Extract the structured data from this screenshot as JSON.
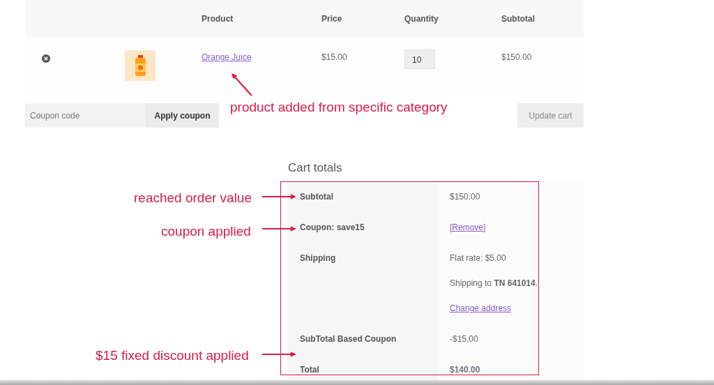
{
  "cart_table": {
    "columns": [
      "Product",
      "Price",
      "Quantity",
      "Subtotal"
    ],
    "items": [
      {
        "product": "Orange Juice",
        "price": "$15.00",
        "quantity": "10",
        "subtotal": "$150.00"
      }
    ]
  },
  "coupon_form": {
    "placeholder": "Coupon code",
    "apply_button": "Apply coupon",
    "update_button": "Update cart"
  },
  "cart_totals": {
    "title": "Cart totals",
    "rows": [
      {
        "kind": "amount",
        "label": "Subtotal",
        "value": "$150.00"
      },
      {
        "kind": "coupon",
        "label": "Coupon: save15",
        "link": "[Remove]"
      },
      {
        "kind": "shipping",
        "label": "Shipping",
        "lines": [
          "Flat rate: $5.00",
          "Shipping to **TN 641014**."
        ],
        "link": "Change address"
      },
      {
        "kind": "amount",
        "label": "SubTotal Based Coupon",
        "value": "-$15.00"
      },
      {
        "kind": "total",
        "label": "Total",
        "value": "$140.00"
      }
    ]
  },
  "annotations": [
    "product added from specific category",
    "reached order value",
    "coupon applied",
    "$15 fixed discount applied"
  ]
}
